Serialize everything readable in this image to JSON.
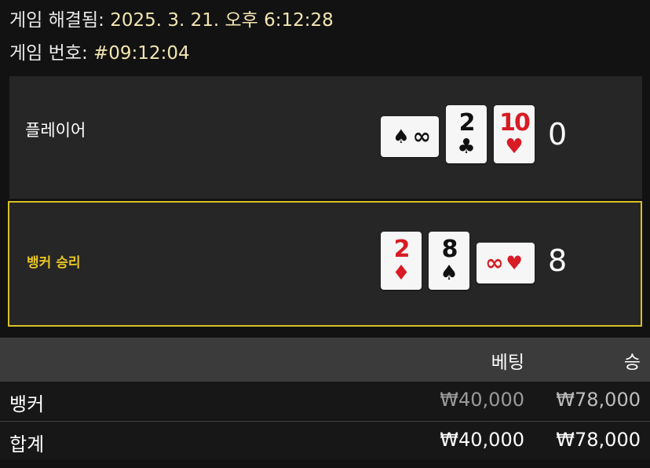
{
  "header": {
    "resolved_label": "게임 해결됨:",
    "resolved_value": "2025. 3. 21. 오후 6:12:28",
    "game_no_label": "게임 번호:",
    "game_no_value": "#09:12:04"
  },
  "player": {
    "label": "플레이어",
    "score": "0",
    "cards": [
      {
        "rank": "∞",
        "suit": "♠",
        "color": "#111111",
        "orientation": "sideways"
      },
      {
        "rank": "2",
        "suit": "♣",
        "color": "#111111",
        "orientation": "upright"
      },
      {
        "rank": "10",
        "suit": "♥",
        "color": "#d81b24",
        "orientation": "upright"
      }
    ]
  },
  "banker": {
    "label": "뱅커 승리",
    "score": "8",
    "cards": [
      {
        "rank": "2",
        "suit": "♦",
        "color": "#d81b24",
        "orientation": "upright"
      },
      {
        "rank": "8",
        "suit": "♠",
        "color": "#111111",
        "orientation": "upright"
      },
      {
        "rank": "∞",
        "suit": "♥",
        "color": "#d81b24",
        "orientation": "sideways"
      }
    ]
  },
  "table": {
    "col_bet": "베팅",
    "col_win": "승",
    "rows": [
      {
        "label": "뱅커",
        "bet": "₩40,000",
        "win": "₩78,000"
      },
      {
        "label": "합계",
        "bet": "₩40,000",
        "win": "₩78,000"
      }
    ]
  },
  "colors": {
    "background": "#121212",
    "panel": "#262626",
    "highlight_border": "#d8c024",
    "winner_label": "#e7c524",
    "red_suit": "#d81b24"
  }
}
